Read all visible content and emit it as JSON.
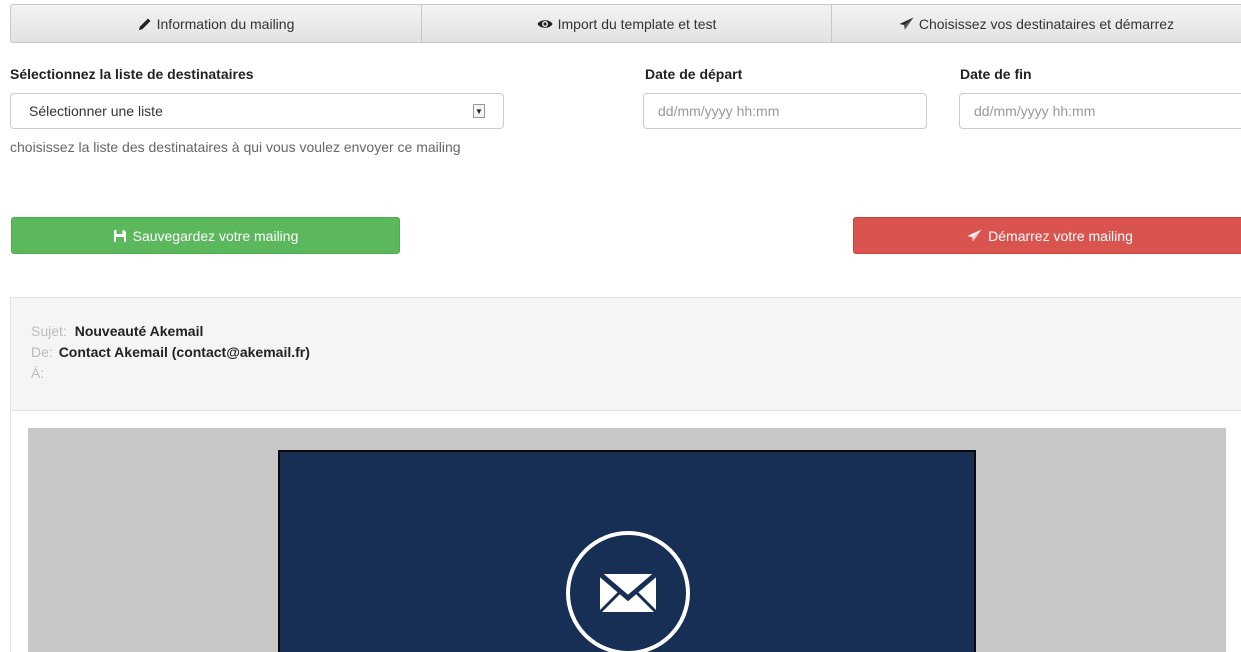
{
  "tabs": [
    {
      "label": "Information du mailing",
      "icon": "pencil-icon"
    },
    {
      "label": "Import du template et test",
      "icon": "eye-icon"
    },
    {
      "label": "Choisissez vos destinataires et démarrez",
      "icon": "paper-plane-icon"
    }
  ],
  "form": {
    "list_label": "Sélectionnez la liste de destinataires",
    "list_selected": "Sélectionner une liste",
    "list_help": "choisissez la liste des destinataires à qui vous voulez envoyer ce mailing",
    "start_label": "Date de départ",
    "start_placeholder": "dd/mm/yyyy hh:mm",
    "end_label": "Date de fin",
    "end_placeholder": "dd/mm/yyyy hh:mm"
  },
  "actions": {
    "save_label": "Sauvegardez votre mailing",
    "start_label": "Démarrez votre mailing"
  },
  "preview": {
    "subject_key": "Sujet:",
    "subject_value": "Nouveauté Akemail",
    "from_key": "De:",
    "from_value": "Contact Akemail (contact@akemail.fr)",
    "to_key": "À:",
    "to_value": ""
  },
  "colors": {
    "success": "#5cb85c",
    "danger": "#d9534f",
    "email_bg": "#172e55",
    "preview_bg": "#c8c8c8"
  }
}
